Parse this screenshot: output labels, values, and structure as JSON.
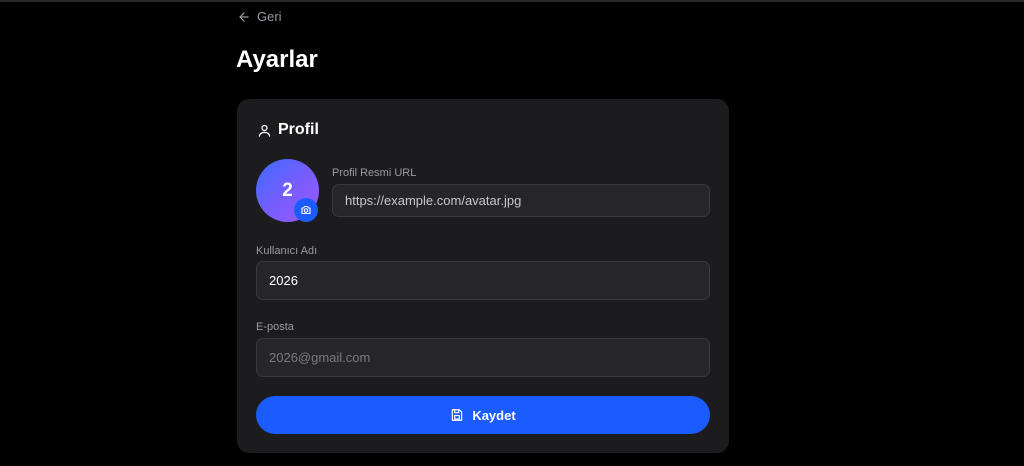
{
  "nav": {
    "back_label": "Geri"
  },
  "page": {
    "title": "Ayarlar"
  },
  "profile": {
    "section_title": "Profil",
    "avatar_initial": "2",
    "avatar_url": {
      "label": "Profil Resmi URL",
      "value": "https://example.com/avatar.jpg"
    },
    "username": {
      "label": "Kullanıcı Adı",
      "value": "2026"
    },
    "email": {
      "label": "E-posta",
      "value": "2026@gmail.com"
    },
    "save_label": "Kaydet"
  },
  "colors": {
    "background": "#000000",
    "card": "#1c1c1e",
    "input": "#262628",
    "accent": "#1a5cff"
  },
  "icons": [
    "arrow-left-icon",
    "user-icon",
    "camera-icon",
    "save-icon"
  ]
}
